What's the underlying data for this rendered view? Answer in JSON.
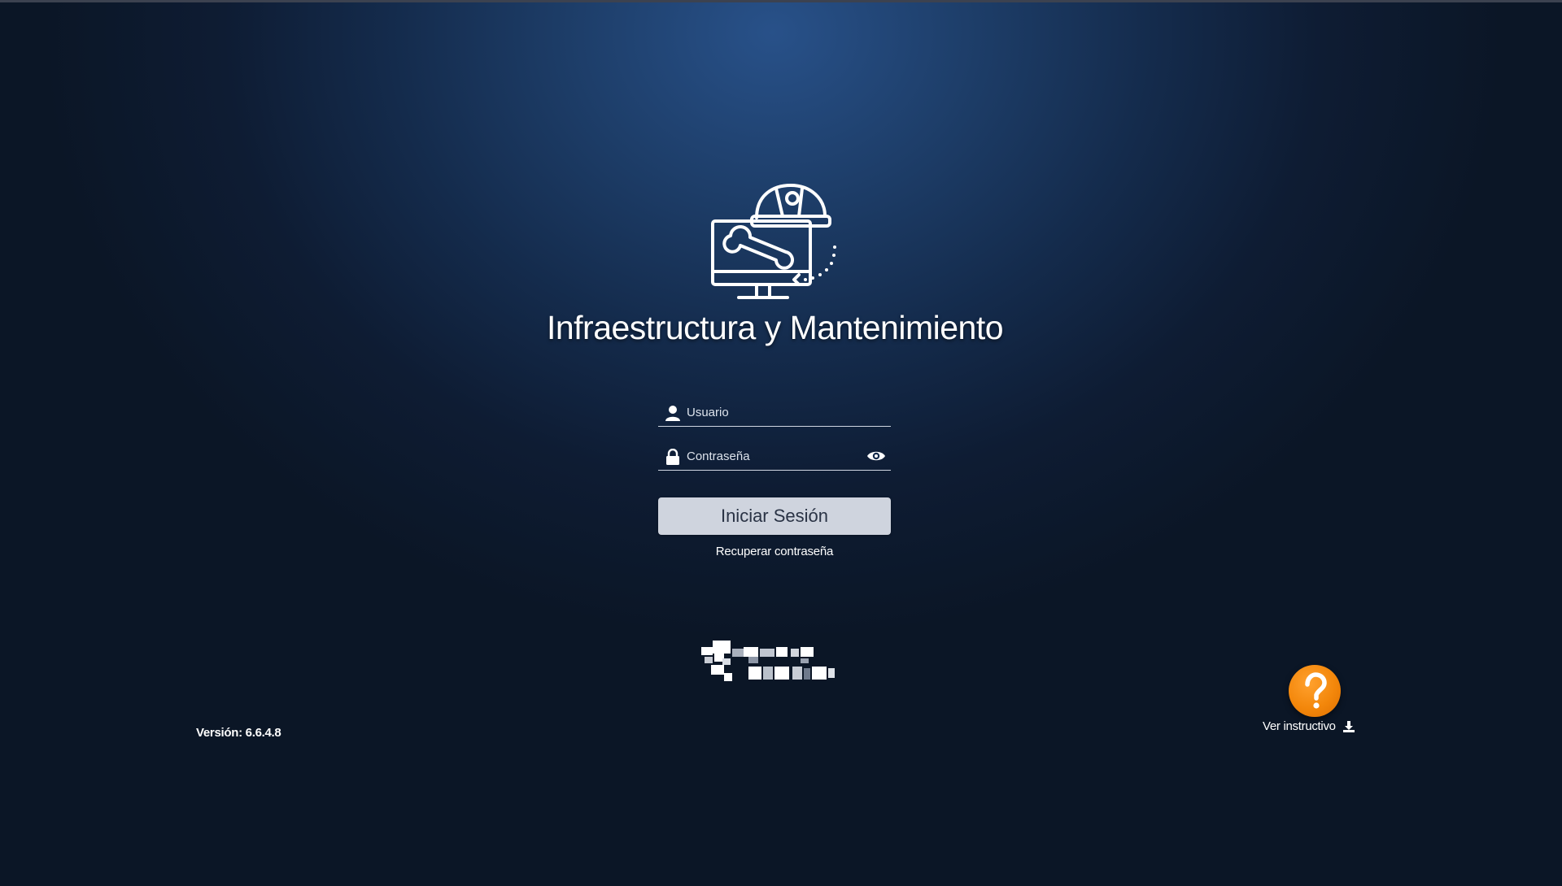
{
  "app": {
    "title": "Infraestructura y Mantenimiento"
  },
  "login": {
    "username_placeholder": "Usuario",
    "password_placeholder": "Contraseña",
    "submit_label": "Iniciar Sesión",
    "recover_label": "Recuperar contraseña"
  },
  "footer": {
    "version": "Versión: 6.6.4.8",
    "help_label": "Ver instructivo"
  },
  "icons": {
    "logo": "monitor-hardhat-wrench-icon",
    "user": "user-icon",
    "lock": "lock-icon",
    "eye": "eye-icon",
    "help": "question-mark-icon",
    "download": "download-icon"
  },
  "colors": {
    "background_center": "#285189",
    "background_edge": "#0b1626",
    "button_bg": "#cfd4de",
    "button_text": "#2a3345",
    "help_orange": "#f3870b"
  }
}
